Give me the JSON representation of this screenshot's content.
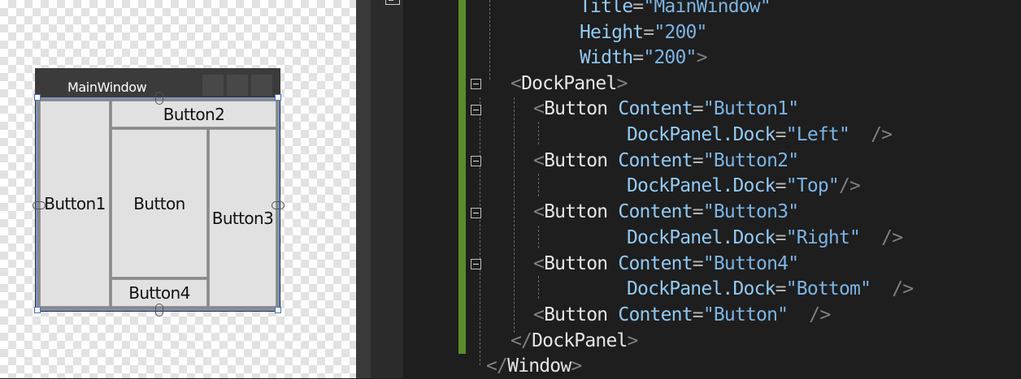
{
  "designer": {
    "window_title": "MainWindow",
    "buttons": {
      "left": "Button1",
      "top": "Button2",
      "right": "Button3",
      "bottom": "Button4",
      "center": "Button"
    }
  },
  "code_lines": [
    {
      "tokens": [
        {
          "t": "attr",
          "v": "Title"
        },
        {
          "t": "eq",
          "v": "="
        },
        {
          "t": "val",
          "v": "\"MainWindow\""
        }
      ]
    },
    {
      "tokens": [
        {
          "t": "attr",
          "v": "Height"
        },
        {
          "t": "eq",
          "v": "="
        },
        {
          "t": "val",
          "v": "\"200\""
        }
      ]
    },
    {
      "tokens": [
        {
          "t": "attr",
          "v": "Width"
        },
        {
          "t": "eq",
          "v": "="
        },
        {
          "t": "val",
          "v": "\"200\""
        },
        {
          "t": "punct",
          "v": ">"
        }
      ]
    },
    {
      "tokens": [
        {
          "t": "punct",
          "v": "<"
        },
        {
          "t": "el",
          "v": "DockPanel"
        },
        {
          "t": "punct",
          "v": ">"
        }
      ]
    },
    {
      "tokens": [
        {
          "t": "punct",
          "v": "<"
        },
        {
          "t": "el",
          "v": "Button"
        },
        {
          "t": "attr",
          "v": " Content"
        },
        {
          "t": "eq",
          "v": "="
        },
        {
          "t": "val",
          "v": "\"Button1\""
        }
      ]
    },
    {
      "tokens": [
        {
          "t": "attr",
          "v": "DockPanel.Dock"
        },
        {
          "t": "eq",
          "v": "="
        },
        {
          "t": "val",
          "v": "\"Left\""
        },
        {
          "t": "punct",
          "v": "  />"
        }
      ]
    },
    {
      "tokens": [
        {
          "t": "punct",
          "v": "<"
        },
        {
          "t": "el",
          "v": "Button"
        },
        {
          "t": "attr",
          "v": " Content"
        },
        {
          "t": "eq",
          "v": "="
        },
        {
          "t": "val",
          "v": "\"Button2\""
        }
      ]
    },
    {
      "tokens": [
        {
          "t": "attr",
          "v": "DockPanel.Dock"
        },
        {
          "t": "eq",
          "v": "="
        },
        {
          "t": "val",
          "v": "\"Top\""
        },
        {
          "t": "punct",
          "v": "/>"
        }
      ]
    },
    {
      "tokens": [
        {
          "t": "punct",
          "v": "<"
        },
        {
          "t": "el",
          "v": "Button"
        },
        {
          "t": "attr",
          "v": " Content"
        },
        {
          "t": "eq",
          "v": "="
        },
        {
          "t": "val",
          "v": "\"Button3\""
        }
      ]
    },
    {
      "tokens": [
        {
          "t": "attr",
          "v": "DockPanel.Dock"
        },
        {
          "t": "eq",
          "v": "="
        },
        {
          "t": "val",
          "v": "\"Right\""
        },
        {
          "t": "punct",
          "v": "  />"
        }
      ]
    },
    {
      "tokens": [
        {
          "t": "punct",
          "v": "<"
        },
        {
          "t": "el",
          "v": "Button"
        },
        {
          "t": "attr",
          "v": " Content"
        },
        {
          "t": "eq",
          "v": "="
        },
        {
          "t": "val",
          "v": "\"Button4\""
        }
      ]
    },
    {
      "tokens": [
        {
          "t": "attr",
          "v": "DockPanel.Dock"
        },
        {
          "t": "eq",
          "v": "="
        },
        {
          "t": "val",
          "v": "\"Bottom\""
        },
        {
          "t": "punct",
          "v": "  />"
        }
      ]
    },
    {
      "tokens": [
        {
          "t": "punct",
          "v": "<"
        },
        {
          "t": "el",
          "v": "Button"
        },
        {
          "t": "attr",
          "v": " Content"
        },
        {
          "t": "eq",
          "v": "="
        },
        {
          "t": "val",
          "v": "\"Button\""
        },
        {
          "t": "punct",
          "v": "  />"
        }
      ]
    },
    {
      "tokens": [
        {
          "t": "punct",
          "v": "</"
        },
        {
          "t": "el",
          "v": "DockPanel"
        },
        {
          "t": "punct",
          "v": ">"
        }
      ]
    },
    {
      "tokens": [
        {
          "t": "punct",
          "v": "</"
        },
        {
          "t": "el",
          "v": "Window"
        },
        {
          "t": "punct",
          "v": ">"
        }
      ]
    }
  ],
  "colors": {
    "element": "#e6e6e6",
    "attribute": "#92caf4",
    "value": "#7bb4e4",
    "punctuation": "#808080",
    "change_bar": "#5a8c2b"
  }
}
